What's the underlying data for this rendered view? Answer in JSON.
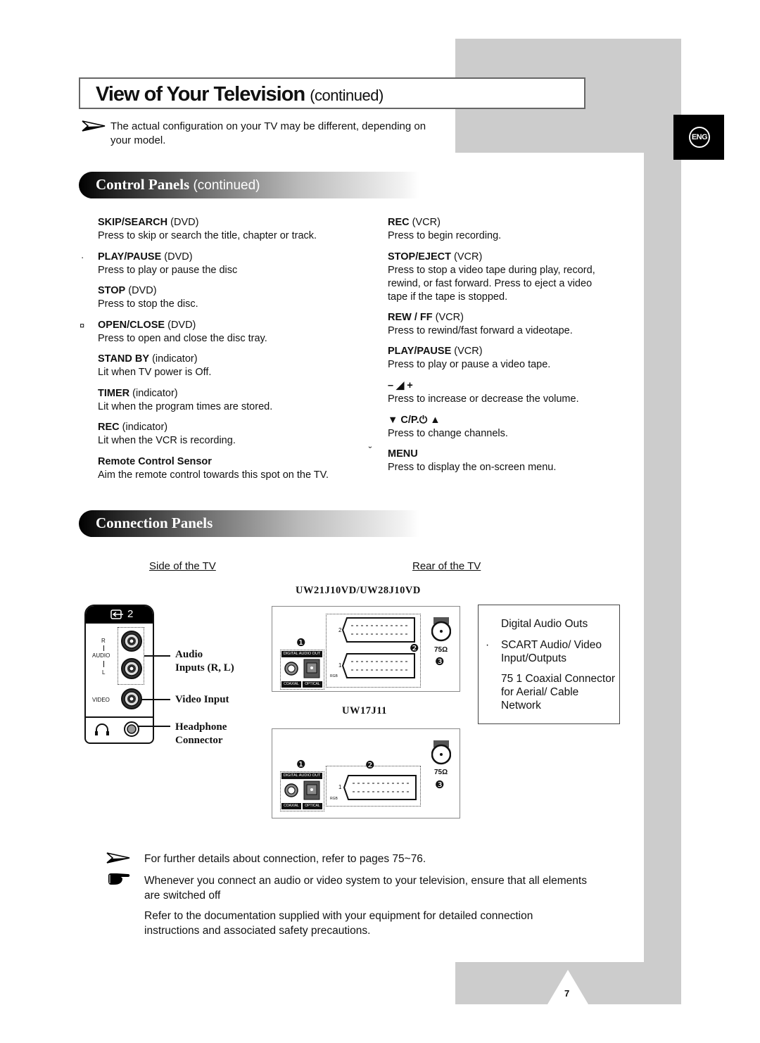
{
  "header": {
    "title_bold": "View of Your Television",
    "title_suffix": "(continued)",
    "note": "The actual configuration on your TV may be different, depending on your model.",
    "language_badge": "ENG"
  },
  "control_panels": {
    "heading": "Control Panels",
    "heading_suffix": "(continued)",
    "left_items": [
      {
        "marker": "",
        "title": "SKIP/SEARCH",
        "qualifier": "(DVD)",
        "desc": "Press to skip or search the title, chapter or track."
      },
      {
        "marker": "·",
        "title": "PLAY/PAUSE",
        "qualifier": "(DVD)",
        "desc": "Press to play or pause the disc"
      },
      {
        "marker": "",
        "title": "STOP",
        "qualifier": "(DVD)",
        "desc": "Press to stop the disc."
      },
      {
        "marker": "¤",
        "title": "OPEN/CLOSE",
        "qualifier": "(DVD)",
        "desc": "Press to open and close the disc tray."
      },
      {
        "marker": "",
        "title": "STAND BY",
        "qualifier": "(indicator)",
        "desc": "Lit when TV power is Off."
      },
      {
        "marker": "",
        "title": "TIMER",
        "qualifier": "(indicator)",
        "desc": "Lit when the program times are stored."
      },
      {
        "marker": "",
        "title": "REC",
        "qualifier": "(indicator)",
        "desc": "Lit when the VCR is recording."
      },
      {
        "marker": "",
        "title": "Remote Control Sensor",
        "qualifier": "",
        "desc": "Aim the remote control towards this spot on the TV."
      }
    ],
    "right_items": [
      {
        "marker": "",
        "title": "REC",
        "qualifier": "(VCR)",
        "desc": "Press to begin recording."
      },
      {
        "marker": "",
        "title": "STOP/EJECT",
        "qualifier": "(VCR)",
        "desc": "Press to stop a video tape during play, record, rewind, or fast forward. Press to eject a video tape if the tape is stopped."
      },
      {
        "marker": "",
        "title": "REW / FF",
        "qualifier": "(VCR)",
        "desc": "Press to rewind/fast forward a videotape."
      },
      {
        "marker": "",
        "title": "PLAY/PAUSE",
        "qualifier": "(VCR)",
        "desc": "Press to play or pause a video tape."
      },
      {
        "marker": "",
        "title": "– ◢ +",
        "qualifier": "",
        "desc": "Press to increase or decrease the volume."
      },
      {
        "marker": "",
        "title": "▼ C/P.⏻ ▲",
        "qualifier": "",
        "desc": "Press to change channels."
      },
      {
        "marker": "˘",
        "title": "MENU",
        "qualifier": "",
        "desc": "Press to display the on-screen menu."
      }
    ]
  },
  "connection_panels": {
    "heading": "Connection Panels",
    "side_label": "Side of the TV",
    "rear_label": "Rear of the TV",
    "model_a": "UW21J10VD/UW28J10VD",
    "model_b": "UW17J11",
    "side_panel": {
      "input_label": "2",
      "audio_label_r": "R",
      "audio_label": "AUDIO",
      "audio_label_l": "L",
      "video_label": "VIDEO",
      "callouts": [
        "Audio",
        "Inputs (R, L)",
        "Video Input",
        "Headphone",
        "Connector"
      ]
    },
    "rear_panel": {
      "digital_audio_out": "DIGITAL AUDIO OUT",
      "coaxial": "COAXIAL",
      "optical": "OPTICAL",
      "scart2": "2",
      "scart1": "1",
      "rgb": "RGB",
      "ohm": "75Ω",
      "markers": [
        "❶",
        "❷",
        "❸"
      ]
    },
    "legend": [
      {
        "marker": "",
        "text": "Digital Audio Outs"
      },
      {
        "marker": "·",
        "text": "SCART Audio/ Video Input/Outputs"
      },
      {
        "marker": "",
        "text": "75 1 Coaxial Connector for Aerial/ Cable Network"
      }
    ]
  },
  "footer_notes": {
    "note1": "For further details about connection, refer to pages 75~76.",
    "note2": "Whenever you connect an audio or video system to your television, ensure that all elements are switched off",
    "note3": "Refer to the documentation supplied with your equipment  for detailed connection instructions and associated safety precautions."
  },
  "page_number": "7"
}
